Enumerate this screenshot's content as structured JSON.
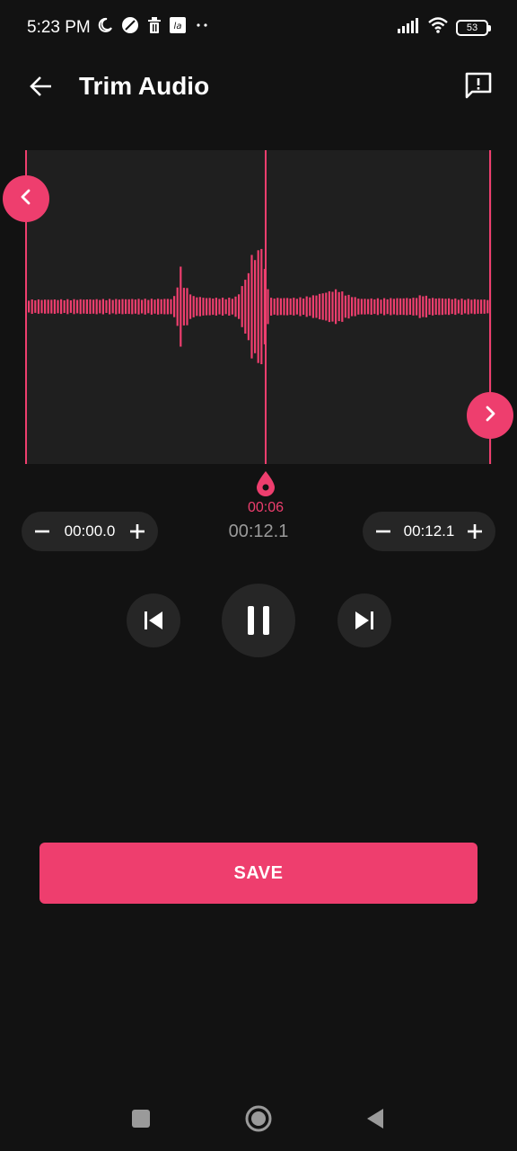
{
  "status_bar": {
    "time": "5:23 PM",
    "battery_level": "53",
    "left_icons": [
      "moon-icon",
      "circle-slash-icon",
      "trash-icon",
      "la-badge-icon",
      "more-dots-icon"
    ],
    "right_icons": [
      "signal-icon",
      "wifi-icon",
      "battery-icon"
    ]
  },
  "app_bar": {
    "title": "Trim Audio",
    "back_icon": "arrow-left-icon",
    "feedback_icon": "message-alert-icon"
  },
  "waveform": {
    "accent_color": "#ee3e6e",
    "panel_color": "#1f1f1f",
    "playhead_position": 0.5,
    "trim_start_fraction": 0.0,
    "trim_end_fraction": 1.0
  },
  "playhead": {
    "time": "00:06"
  },
  "total_duration": "00:12.1",
  "trim_start": {
    "value": "00:00.0",
    "minus_icon": "minus-icon",
    "plus_icon": "plus-icon"
  },
  "trim_end": {
    "value": "00:12.1",
    "minus_icon": "minus-icon",
    "plus_icon": "plus-icon"
  },
  "controls": {
    "prev_icon": "skip-previous-icon",
    "pause_icon": "pause-icon",
    "next_icon": "skip-next-icon"
  },
  "save": {
    "label": "SAVE"
  },
  "nav_bar": {
    "recents_icon": "square-icon",
    "home_icon": "circle-icon",
    "back_icon": "triangle-back-icon"
  }
}
